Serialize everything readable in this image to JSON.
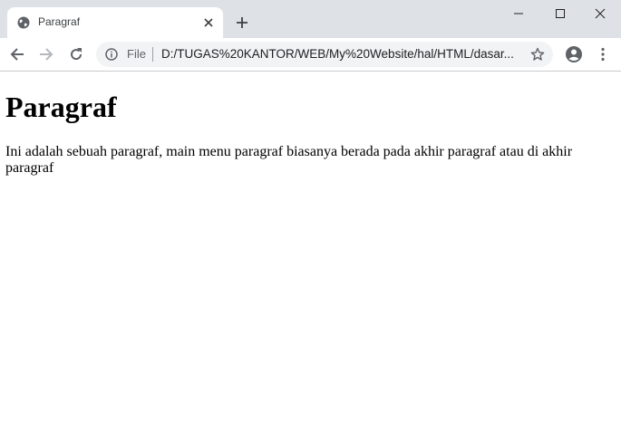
{
  "tab": {
    "title": "Paragraf",
    "favicon_icon": "globe-icon",
    "close_icon": "close-icon"
  },
  "new_tab_icon": "plus-icon",
  "window_controls": [
    "minimize-icon",
    "maximize-icon",
    "close-icon"
  ],
  "toolbar": {
    "back_icon": "back-arrow-icon",
    "forward_icon": "forward-arrow-icon",
    "reload_icon": "reload-icon",
    "profile_icon": "account-circle-icon",
    "menu_icon": "more-vertical-icon"
  },
  "omnibox": {
    "info_icon": "info-icon",
    "scheme_label": "File",
    "url": "D:/TUGAS%20KANTOR/WEB/My%20Website/hal/HTML/dasar...",
    "bookmark_icon": "star-icon"
  },
  "page": {
    "heading": "Paragraf",
    "paragraph": "Ini adalah sebuah paragraf, main menu paragraf biasanya berada pada akhir paragraf atau di akhir paragraf"
  },
  "colors": {
    "tabstrip_bg": "#dee1e6",
    "omnibox_bg": "#f1f3f4",
    "icon_gray": "#5f6368"
  }
}
